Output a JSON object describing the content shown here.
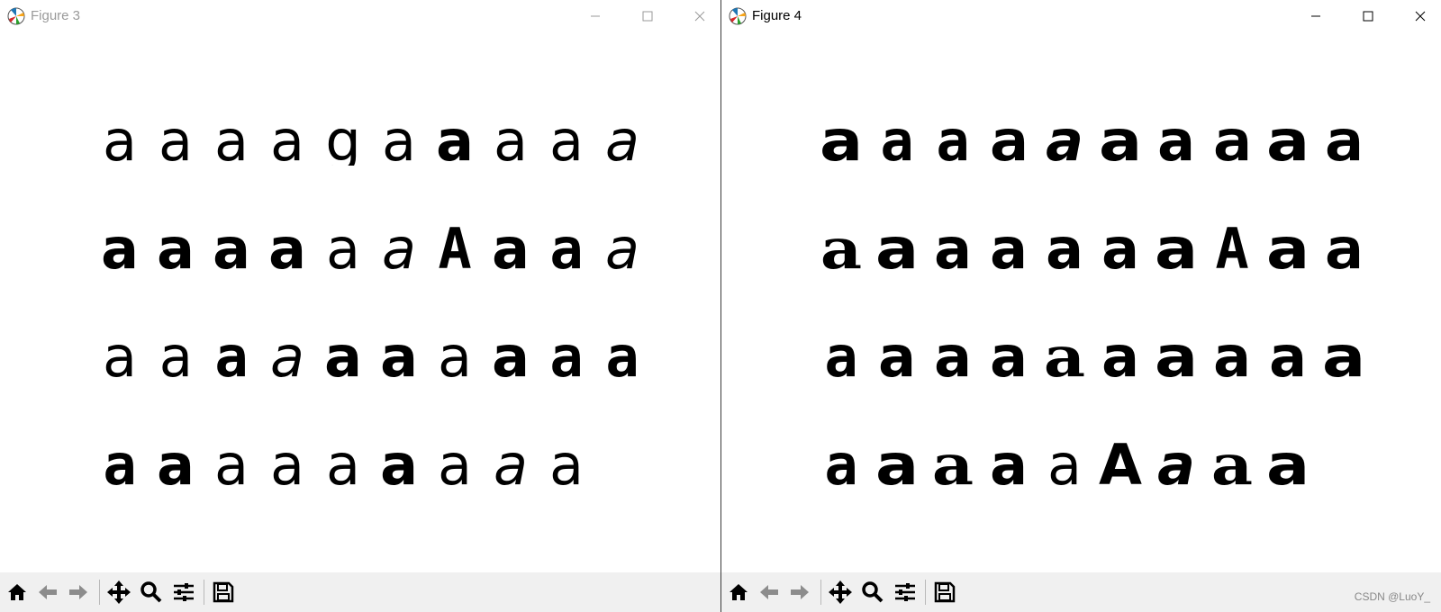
{
  "windows": {
    "left": {
      "title": "Figure 3",
      "glyph_rows": [
        [
          "a",
          "a",
          "a",
          "a",
          "g",
          "a",
          "a",
          "a",
          "a",
          "a"
        ],
        [
          "a",
          "a",
          "a",
          "a",
          "a",
          "a",
          "A",
          "a",
          "a",
          "a"
        ],
        [
          "a",
          "a",
          "a",
          "a",
          "a",
          "a",
          "a",
          "a",
          "a",
          "a"
        ],
        [
          "a",
          "a",
          "a",
          "a",
          "a",
          "a",
          "a",
          "a",
          "a"
        ]
      ]
    },
    "right": {
      "title": "Figure 4",
      "glyph_rows": [
        [
          "a",
          "a",
          "a",
          "a",
          "a",
          "a",
          "a",
          "a",
          "a",
          "a"
        ],
        [
          "a",
          "a",
          "a",
          "a",
          "a",
          "a",
          "a",
          "A",
          "a",
          "a"
        ],
        [
          "a",
          "a",
          "a",
          "a",
          "a",
          "a",
          "a",
          "a",
          "a",
          "a"
        ],
        [
          "a",
          "a",
          "a",
          "a",
          "a",
          "A",
          "a",
          "a",
          "a"
        ]
      ]
    }
  },
  "toolbar_icons": [
    "home-icon",
    "back-icon",
    "forward-icon",
    "pan-icon",
    "zoom-icon",
    "configure-icon",
    "save-icon"
  ],
  "watermark": "CSDN @LuoY_",
  "colors": {
    "titlebar": "#ffffff",
    "toolbar": "#f0f0f0",
    "glyph": "#000000",
    "inactive_title": "#9a9a9a"
  }
}
